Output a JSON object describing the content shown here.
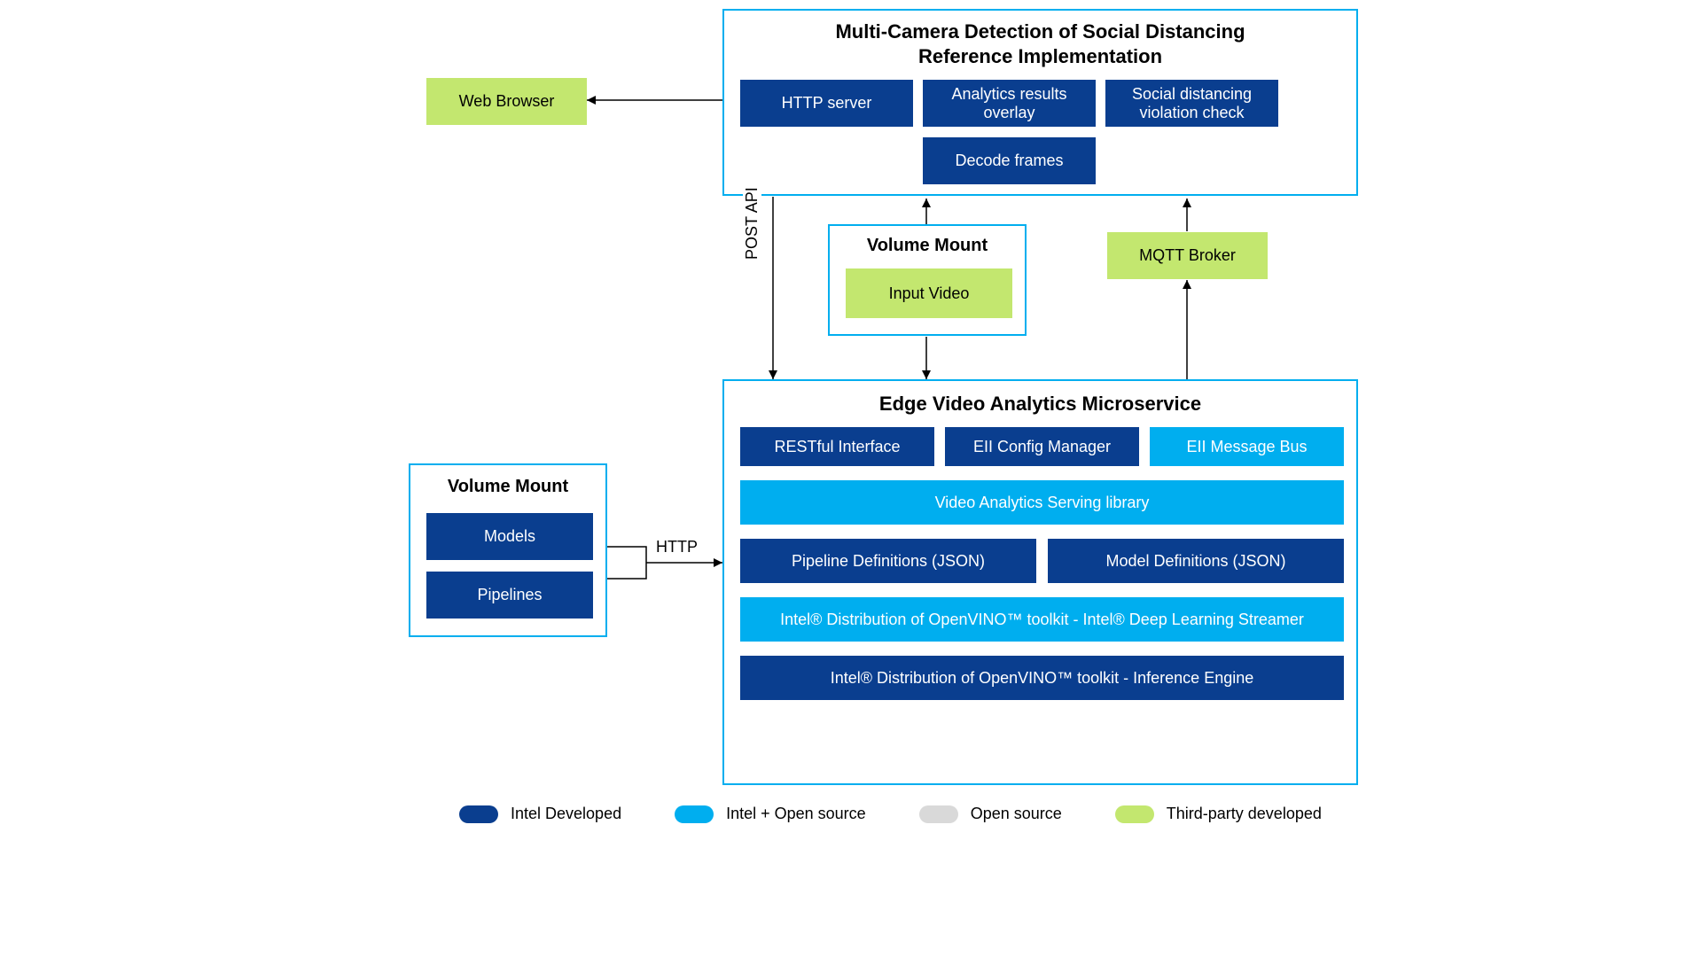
{
  "topContainer": {
    "title": "Multi-Camera Detection of Social Distancing\nReference Implementation",
    "boxes": {
      "httpServer": "HTTP server",
      "analyticsOverlay": "Analytics results overlay",
      "violationCheck": "Social distancing violation check",
      "decodeFrames": "Decode frames"
    }
  },
  "webBrowser": "Web Browser",
  "volumeMountMid": {
    "title": "Volume Mount",
    "inputVideo": "Input Video"
  },
  "mqttBroker": "MQTT Broker",
  "volumeMountLeft": {
    "title": "Volume Mount",
    "models": "Models",
    "pipelines": "Pipelines"
  },
  "evam": {
    "title": "Edge Video Analytics Microservice",
    "restful": "RESTful Interface",
    "eiiConfig": "EII Config Manager",
    "eiiMsgBus": "EII Message Bus",
    "vasLib": "Video Analytics Serving library",
    "pipelineDefs": "Pipeline Definitions (JSON)",
    "modelDefs": "Model Definitions (JSON)",
    "openvinoStreamer": "Intel® Distribution of OpenVINO™ toolkit - Intel® Deep Learning Streamer",
    "openvinoInference": "Intel® Distribution of OpenVINO™ toolkit - Inference Engine"
  },
  "edgeLabels": {
    "postApi": "POST API",
    "http": "HTTP"
  },
  "legend": {
    "intelDev": "Intel Developed",
    "intelOpen": "Intel + Open source",
    "openSource": "Open source",
    "thirdParty": "Third-party developed"
  }
}
